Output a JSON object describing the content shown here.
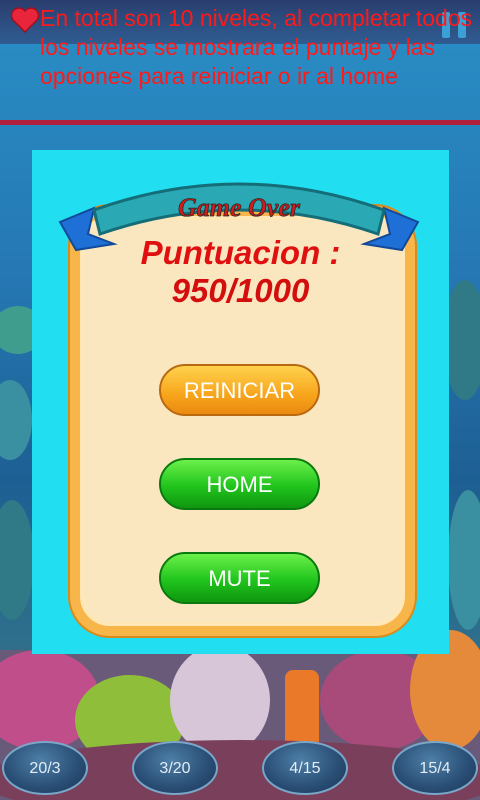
{
  "instructions": "En total son 10 niveles, al completar todos los niveles se mostrara el puntaje y las opciones para reiniciar o ir al home",
  "dialog": {
    "banner": "Game Over",
    "score_label": "Puntuacion :",
    "score_value": "950/1000",
    "buttons": {
      "restart": "REINICIAR",
      "home": "HOME",
      "mute": "MUTE"
    }
  },
  "bottom_bubbles": [
    "20/3",
    "3/20",
    "4/15",
    "15/4"
  ],
  "colors": {
    "dialog_bg": "#21dff0",
    "card_bg": "#fbe7bf",
    "card_border": "#f8b64a",
    "score_text": "#e01010",
    "restart_button": "#f7a51c",
    "green_button": "#1fc41c",
    "instructions_text": "#ff1a1a"
  },
  "icons": {
    "lives": "heart-icon",
    "pause": "pause-icon"
  }
}
